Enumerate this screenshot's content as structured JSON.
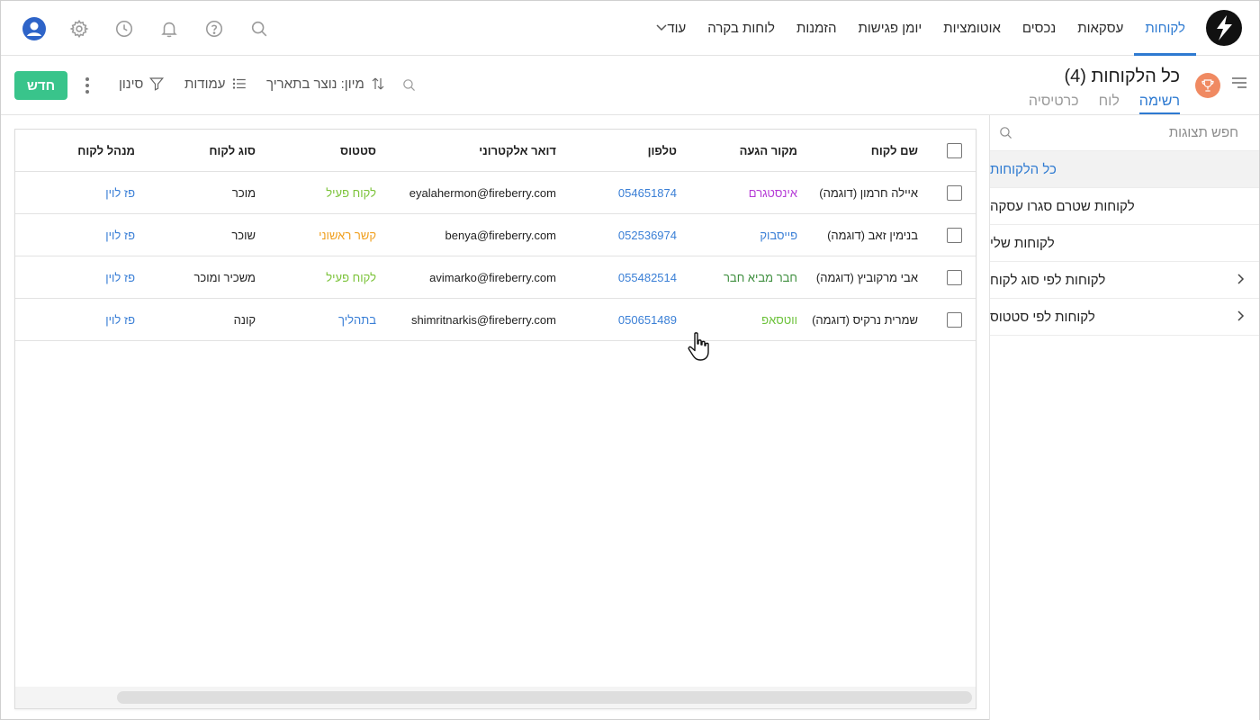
{
  "nav": {
    "items": [
      {
        "label": "לקוחות",
        "active": true
      },
      {
        "label": "עסקאות"
      },
      {
        "label": "נכסים"
      },
      {
        "label": "אוטומציות"
      },
      {
        "label": "יומן פגישות"
      },
      {
        "label": "הזמנות"
      },
      {
        "label": "לוחות בקרה"
      },
      {
        "label": "עוד"
      }
    ],
    "icons": [
      "search-icon",
      "help-icon",
      "bell-icon",
      "clock-icon",
      "gear-icon",
      "user-avatar-icon"
    ]
  },
  "header": {
    "title": "כל הלקוחות (4)",
    "tabs": [
      {
        "label": "רשימה",
        "active": true
      },
      {
        "label": "לוח"
      },
      {
        "label": "כרטיסיה"
      }
    ],
    "sort_label": "מיון: נוצר בתאריך",
    "columns_label": "עמודות",
    "filter_label": "סינון",
    "new_button": "חדש"
  },
  "sidebar": {
    "search_placeholder": "חפש תצוגות",
    "items": [
      {
        "label": "כל הלקוחות",
        "selected": true
      },
      {
        "label": "לקוחות שטרם סגרו עסקה"
      },
      {
        "label": "לקוחות שלי"
      },
      {
        "label": "לקוחות לפי סוג לקוח",
        "expandable": true
      },
      {
        "label": "לקוחות לפי סטטוס",
        "expandable": true
      }
    ]
  },
  "table": {
    "headers": {
      "name": "שם לקוח",
      "source": "מקור הגעה",
      "phone": "טלפון",
      "email": "דואר אלקטרוני",
      "status": "סטטוס",
      "type": "סוג לקוח",
      "manager": "מנהל לקוח"
    },
    "rows": [
      {
        "name": "איילה חרמון (דוגמה)",
        "source": "אינסטגרם",
        "source_color": "#b53bd6",
        "phone": "054651874",
        "email": "eyalahermon@fireberry.com",
        "status": "לקוח פעיל",
        "status_color": "#7cc33a",
        "type": "מוכר",
        "manager": "פז לוין"
      },
      {
        "name": "בנימין זאב (דוגמה)",
        "source": "פייסבוק",
        "source_color": "#3a7fd6",
        "phone": "052536974",
        "email": "benya@fireberry.com",
        "status": "קשר ראשוני",
        "status_color": "#f0a020",
        "type": "שוכר",
        "manager": "פז לוין"
      },
      {
        "name": "אבי מרקוביץ (דוגמה)",
        "source": "חבר מביא חבר",
        "source_color": "#3f8f3f",
        "phone": "055482514",
        "email": "avimarko@fireberry.com",
        "status": "לקוח פעיל",
        "status_color": "#7cc33a",
        "type": "משכיר ומוכר",
        "manager": "פז לוין"
      },
      {
        "name": "שמרית נרקיס (דוגמה)",
        "source": "ווטסאפ",
        "source_color": "#6cc23a",
        "phone": "050651489",
        "email": "shimritnarkis@fireberry.com",
        "status": "בתהליך",
        "status_color": "#3a7fd6",
        "type": "קונה",
        "manager": "פז לוין"
      }
    ]
  },
  "colors": {
    "accent": "#2e7ad1",
    "new_button": "#39c48b",
    "trophy": "#f08a62"
  }
}
